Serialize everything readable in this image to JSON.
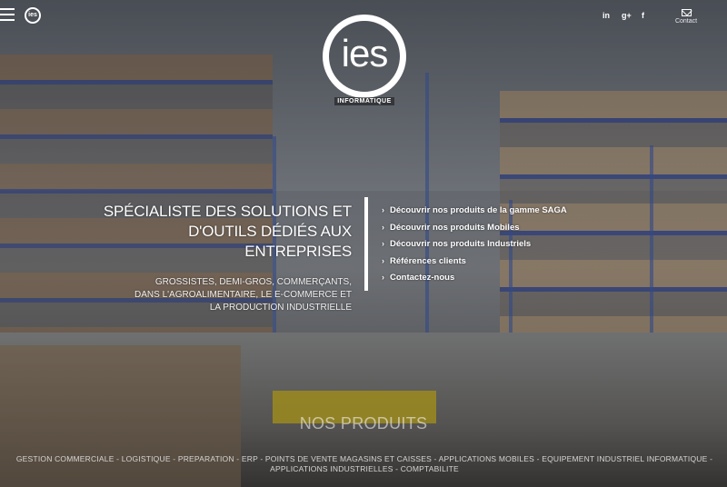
{
  "brand": {
    "logo_word": "ies",
    "logo_sub": "INFORMATIQUE",
    "small_logo": "ies"
  },
  "header": {
    "social": [
      {
        "icon": "linkedin-icon",
        "glyph": "in"
      },
      {
        "icon": "google-plus-icon",
        "glyph": "g+"
      },
      {
        "icon": "facebook-icon",
        "glyph": "f"
      }
    ],
    "contact_label": "Contact"
  },
  "hero": {
    "title_line1": "SPÉCIALISTE DES SOLUTIONS ET",
    "title_line2": "D'OUTILS DÉDIÉS AUX ENTREPRISES",
    "desc_line1": "GROSSISTES, DEMI-GROS, COMMERÇANTS,",
    "desc_line2": "DANS L'AGROALIMENTAIRE, LE E-COMMERCE ET",
    "desc_line3": "LA PRODUCTION INDUSTRIELLE"
  },
  "menu": [
    "Découvrir nos produits de la gamme SAGA",
    "Découvrir nos produits Mobiles",
    "Découvrir nos produits Industriels",
    "Références clients",
    "Contactez-nous"
  ],
  "products": {
    "title": "NOS PRODUITS",
    "list": "GESTION COMMERCIALE - LOGISTIQUE - PREPARATION - ERP - POINTS DE VENTE MAGASINS ET CAISSES - APPLICATIONS MOBILES - EQUIPEMENT INDUSTRIEL INFORMATIQUE - APPLICATIONS INDUSTRIELLES - COMPTABILITE"
  },
  "colors": {
    "accent": "#ffffff",
    "rack_blue": "#2b3f96",
    "safety_yellow": "#c9b01e"
  }
}
